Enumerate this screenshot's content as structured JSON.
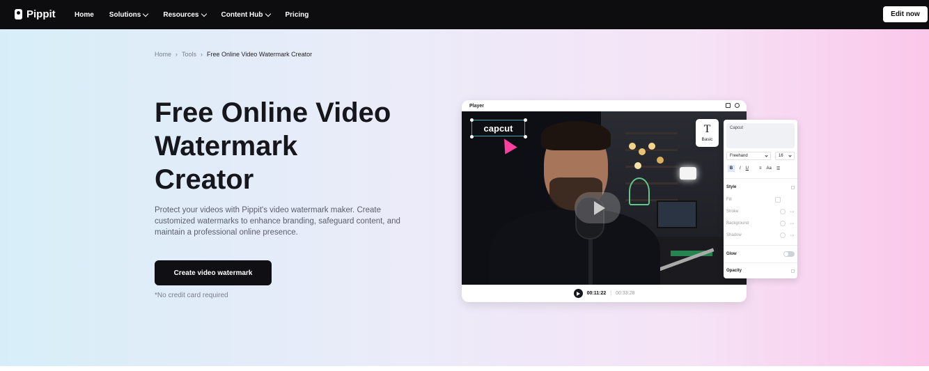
{
  "nav": {
    "brand": "Pippit",
    "items": [
      {
        "label": "Home",
        "dropdown": false
      },
      {
        "label": "Solutions",
        "dropdown": true
      },
      {
        "label": "Resources",
        "dropdown": true
      },
      {
        "label": "Content Hub",
        "dropdown": true
      },
      {
        "label": "Pricing",
        "dropdown": false
      }
    ],
    "edit_button": "Edit now"
  },
  "breadcrumb": {
    "items": [
      "Home",
      "Tools",
      "Free Online Video Watermark Creator"
    ],
    "separator": "›"
  },
  "hero": {
    "title_lines": [
      "Free Online Video",
      "Watermark",
      "Creator"
    ],
    "description": "Protect your videos with Pippit's video watermark maker. Create customized watermarks to enhance branding, safeguard content, and maintain a professional online presence.",
    "cta": "Create video watermark",
    "note": "*No credit card required"
  },
  "player": {
    "title": "Player",
    "watermark_text": "capcut",
    "current_time": "00:11:22",
    "separator": "|",
    "total_time": "00:33:28"
  },
  "basic_tab": {
    "glyph": "T",
    "label": "Basic"
  },
  "panel": {
    "text_value": "Capcut",
    "font_select": "Freehand",
    "size_select": "16",
    "format_buttons": [
      "B",
      "I",
      "U"
    ],
    "align_glyph": "≡",
    "case_glyph": "Aa",
    "list_glyph": "☰",
    "style_header": "Style",
    "style_rows": [
      "Fill",
      "Stroke",
      "Background",
      "Shadow"
    ],
    "glow_label": "Glow",
    "opacity_label": "Opacity",
    "more_glyph": "···"
  },
  "colors": {
    "nav_bg": "#0d0d10",
    "cta_bg": "#101014",
    "cursor_accent": "#ff3fa0",
    "selection_border": "#3aa7b0"
  }
}
